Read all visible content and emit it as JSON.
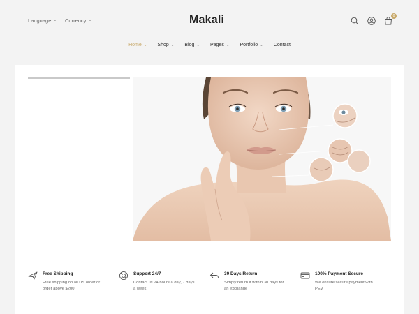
{
  "header": {
    "language_label": "Language",
    "currency_label": "Currency",
    "logo_text": "akali",
    "logo_mark": "M",
    "cart_count": "0"
  },
  "nav": {
    "items": [
      {
        "label": "Home",
        "active": true,
        "has_dropdown": true
      },
      {
        "label": "Shop",
        "has_dropdown": true
      },
      {
        "label": "Blog",
        "has_dropdown": true
      },
      {
        "label": "Pages",
        "has_dropdown": true
      },
      {
        "label": "Portfolio",
        "has_dropdown": true
      },
      {
        "label": "Contact",
        "has_dropdown": false
      }
    ]
  },
  "slider": {
    "progress": 0.28
  },
  "features": [
    {
      "icon": "airplane-icon",
      "title": "Free Shipping",
      "desc": "Free shipping on all US order or order above $200"
    },
    {
      "icon": "lifebuoy-icon",
      "title": "Support 24/7",
      "desc": "Contact us 24 hours a day, 7 days a week"
    },
    {
      "icon": "return-icon",
      "title": "30 Days Return",
      "desc": "Simply return it within 30 days for an exchange"
    },
    {
      "icon": "credit-card-icon",
      "title": "100% Payment Secure",
      "desc": "We ensure secure payment with PEV"
    }
  ],
  "colors": {
    "accent": "#c8a96a",
    "page_bg": "#f3f3f3",
    "card_bg": "#ffffff",
    "text": "#333333"
  }
}
